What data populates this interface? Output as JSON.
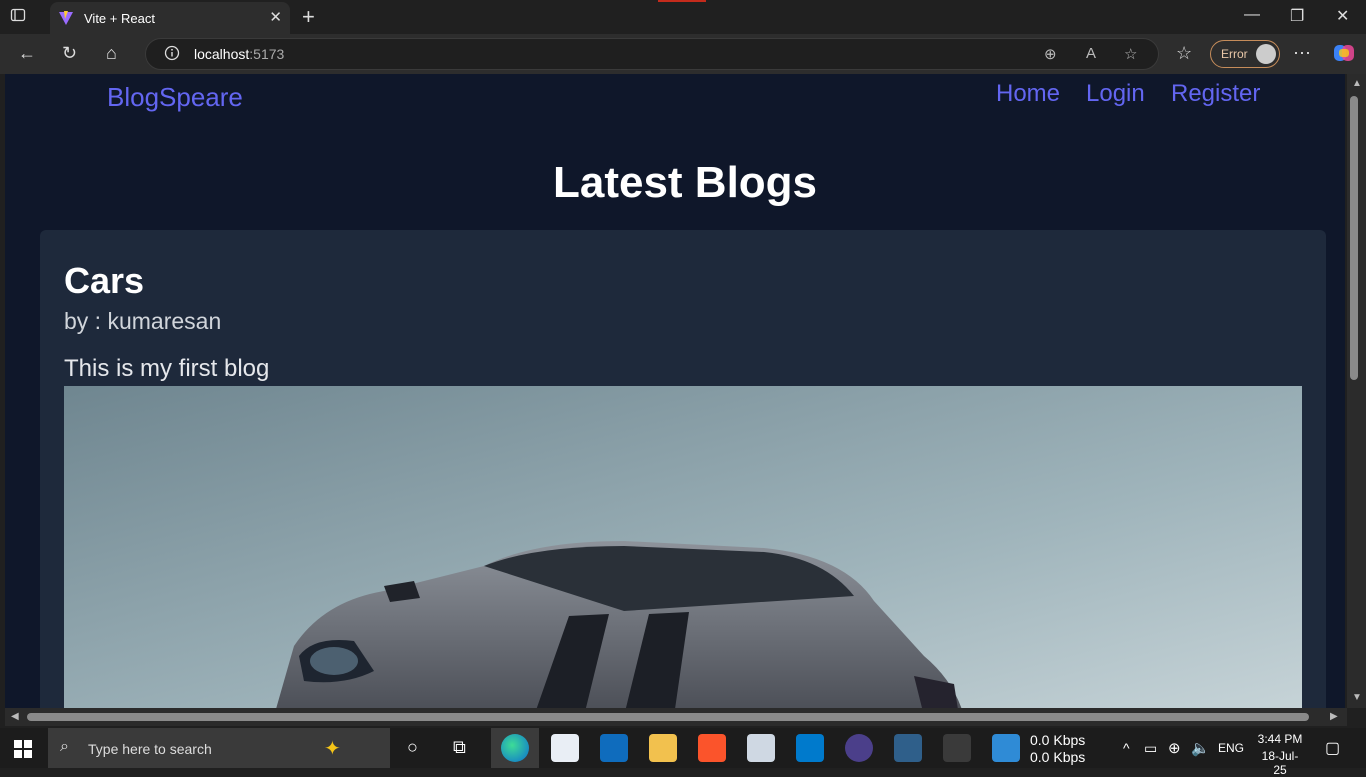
{
  "browser": {
    "tab_title": "Vite + React",
    "url_host": "localhost",
    "url_port": ":5173",
    "profile_status": "Error"
  },
  "app": {
    "brand": "BlogSpeare",
    "nav": {
      "home": "Home",
      "login": "Login",
      "register": "Register"
    },
    "page_title": "Latest Blogs",
    "posts": [
      {
        "title": "Cars",
        "author": "by : kumaresan",
        "body": "This is my first blog"
      }
    ]
  },
  "taskbar": {
    "search_placeholder": "Type here to search",
    "net_down": "0.0 Kbps",
    "net_up": "0.0 Kbps",
    "language": "ENG",
    "time": "3:44 PM",
    "date": "18-Jul-25"
  },
  "colors": {
    "page_bg": "#0f172a",
    "card_bg": "#1e293b",
    "accent": "#6366f1"
  }
}
